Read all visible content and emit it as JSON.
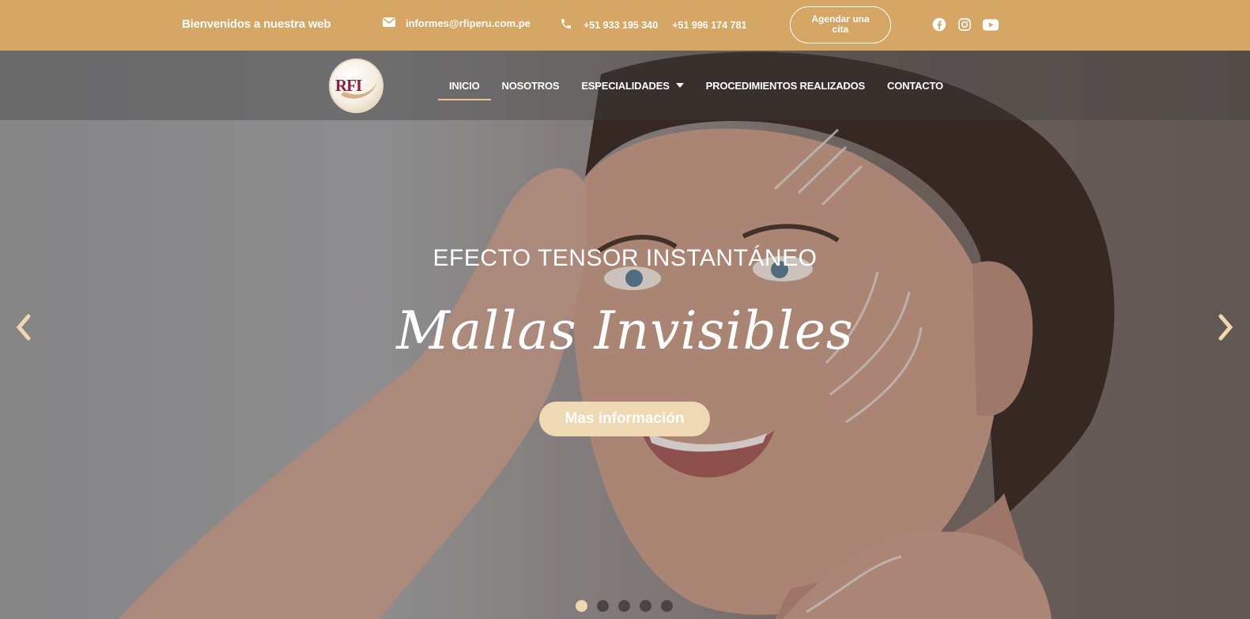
{
  "topbar": {
    "welcome": "Bienvenidos a nuestra web",
    "email": "informes@rfiperu.com.pe",
    "phone_1": "+51 933 195 340",
    "phone_2": "+51 996 174 781",
    "cta_label_line1": "Agendar una",
    "cta_label_line2": "cita",
    "socials": [
      "facebook-icon",
      "instagram-icon",
      "youtube-icon"
    ],
    "bg_color": "#d5a664"
  },
  "nav": {
    "logo_text": "RFI",
    "items": [
      {
        "label": "INICIO",
        "active": true
      },
      {
        "label": "NOSOTROS",
        "active": false
      },
      {
        "label": "ESPECIALIDADES",
        "active": false,
        "has_dropdown": true
      },
      {
        "label": "PROCEDIMIENTOS REALIZADOS",
        "active": false
      },
      {
        "label": "CONTACTO",
        "active": false
      }
    ]
  },
  "hero": {
    "kicker": "EFECTO TENSOR INSTANTÁNEO",
    "title": "Mallas Invisibles",
    "button_label": "Mas información",
    "button_color": "#efd9b2",
    "slide_count": 5,
    "active_slide": 1
  }
}
